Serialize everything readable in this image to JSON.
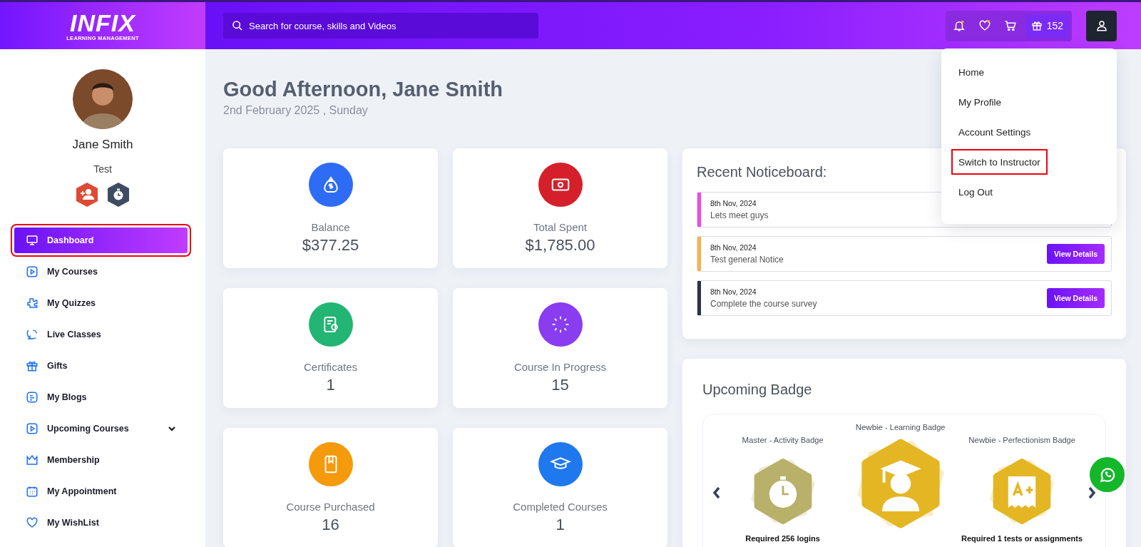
{
  "logo": {
    "wordmark": "INFIX",
    "tagline": "LEARNING MANAGEMENT"
  },
  "search": {
    "placeholder": "Search for course, skills and Videos"
  },
  "header_icons": {
    "gift_count": "152"
  },
  "profile": {
    "name": "Jane Smith",
    "role": "Test"
  },
  "sidebar": {
    "items": [
      {
        "label": "Dashboard",
        "selected": true,
        "highlighted": true
      },
      {
        "label": "My Courses",
        "selected": false,
        "highlighted": false
      },
      {
        "label": "My Quizzes",
        "selected": false,
        "highlighted": false
      },
      {
        "label": "Live Classes",
        "selected": false,
        "highlighted": false
      },
      {
        "label": "Gifts",
        "selected": false,
        "highlighted": false
      },
      {
        "label": "My Blogs",
        "selected": false,
        "highlighted": false
      },
      {
        "label": "Upcoming Courses",
        "selected": false,
        "highlighted": false,
        "expandable": true
      },
      {
        "label": "Membership",
        "selected": false,
        "highlighted": false
      },
      {
        "label": "My Appointment",
        "selected": false,
        "highlighted": false
      },
      {
        "label": "My WishList",
        "selected": false,
        "highlighted": false
      }
    ]
  },
  "greeting": {
    "title": "Good Afternoon, Jane Smith",
    "date": "2nd February 2025 , Sunday"
  },
  "stats": [
    {
      "label": "Balance",
      "value": "$377.25",
      "color": "#2f6cf6"
    },
    {
      "label": "Total Spent",
      "value": "$1,785.00",
      "color": "#d5202b"
    },
    {
      "label": "Certificates",
      "value": "1",
      "color": "#22b573"
    },
    {
      "label": "Course In Progress",
      "value": "15",
      "color": "#8a3cf0"
    },
    {
      "label": "Course Purchased",
      "value": "16",
      "color": "#f59a0b"
    },
    {
      "label": "Completed Courses",
      "value": "1",
      "color": "#1f78ee"
    }
  ],
  "noticeboard": {
    "title": "Recent Noticeboard:",
    "notices": [
      {
        "date": "8th Nov, 2024",
        "title": "Lets meet guys",
        "color": "#f048e8"
      },
      {
        "date": "8th Nov, 2024",
        "title": "Test general Notice",
        "color": "#f7b24a",
        "button": "View Details"
      },
      {
        "date": "8th Nov, 2024",
        "title": "Complete the course survey",
        "color": "#2c3447",
        "button": "View Details"
      }
    ]
  },
  "badges": {
    "title": "Upcoming Badge",
    "items": [
      {
        "rank": "Master",
        "name": "- Activity Badge",
        "color": "#b9b06a",
        "featured": false,
        "requirement": "Required 256 logins"
      },
      {
        "rank": "Newbie",
        "name": "- Learning Badge",
        "color": "#e4b623",
        "featured": true
      },
      {
        "rank": "Newbie",
        "name": "- Perfectionism Badge",
        "color": "#e4b623",
        "featured": false,
        "requirement": "Required **1** tests or assignments"
      }
    ]
  },
  "user_menu": {
    "items": [
      {
        "label": "Home",
        "highlighted": false
      },
      {
        "label": "My Profile",
        "highlighted": false
      },
      {
        "label": "Account Settings",
        "highlighted": false
      },
      {
        "label": "Switch to Instructor",
        "highlighted": true
      },
      {
        "label": "Log Out",
        "highlighted": false
      }
    ]
  }
}
